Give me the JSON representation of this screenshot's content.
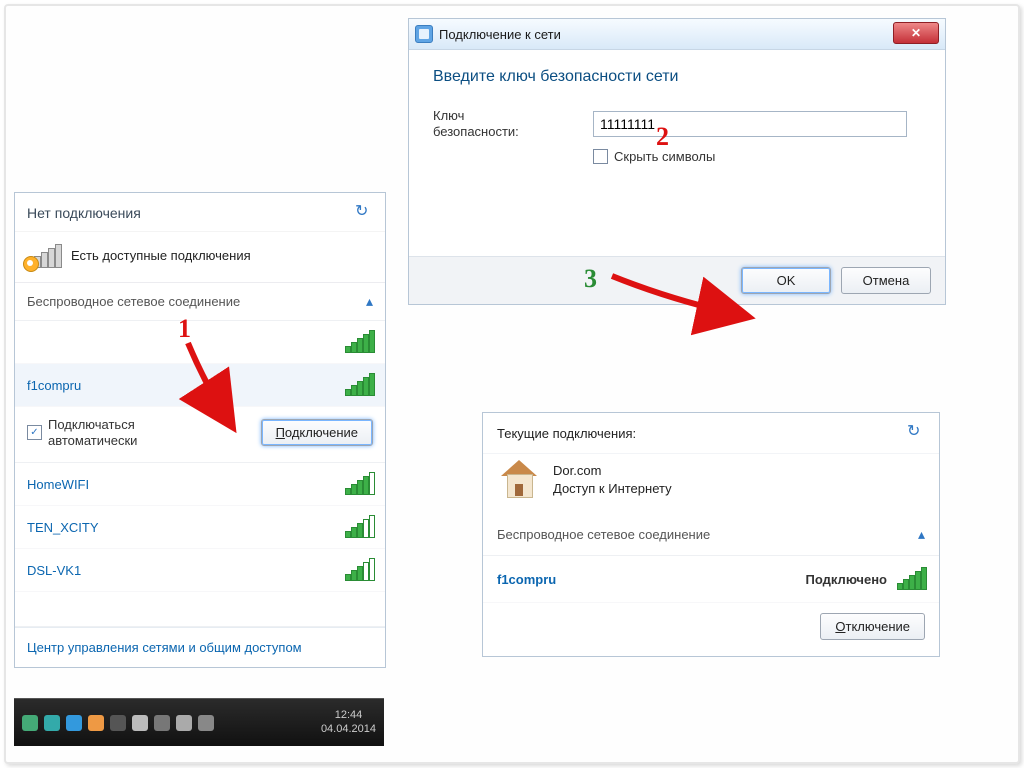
{
  "panel1": {
    "header": "Нет подключения",
    "available": "Есть доступные подключения",
    "wireless_section": "Беспроводное сетевое соединение",
    "networks": [
      {
        "name": "",
        "signal": "s5"
      },
      {
        "name": "f1compru",
        "signal": "s5",
        "selected": true
      },
      {
        "name": "HomeWIFI",
        "signal": "s4"
      },
      {
        "name": "TEN_XCITY",
        "signal": "s3"
      },
      {
        "name": "DSL-VK1",
        "signal": "s3"
      }
    ],
    "auto_connect": "Подключаться автоматически",
    "connect_btn": "Подключение",
    "footer_link": "Центр управления сетями и общим доступом"
  },
  "taskbar": {
    "time": "12:44",
    "date": "04.04.2014"
  },
  "panel2": {
    "title": "Подключение к сети",
    "heading": "Введите ключ безопасности сети",
    "key_label": "Ключ безопасности:",
    "key_value": "11111111",
    "hide_label": "Скрыть символы",
    "ok": "OK",
    "cancel": "Отмена"
  },
  "panel3": {
    "header": "Текущие подключения:",
    "network_name": "Dor.com",
    "access": "Доступ к Интернету",
    "wireless_section": "Беспроводное сетевое соединение",
    "connected_net": "f1compru",
    "status": "Подключено",
    "disconnect": "Отключение"
  },
  "annotations": {
    "n1": "1",
    "n2": "2",
    "n3": "3"
  }
}
